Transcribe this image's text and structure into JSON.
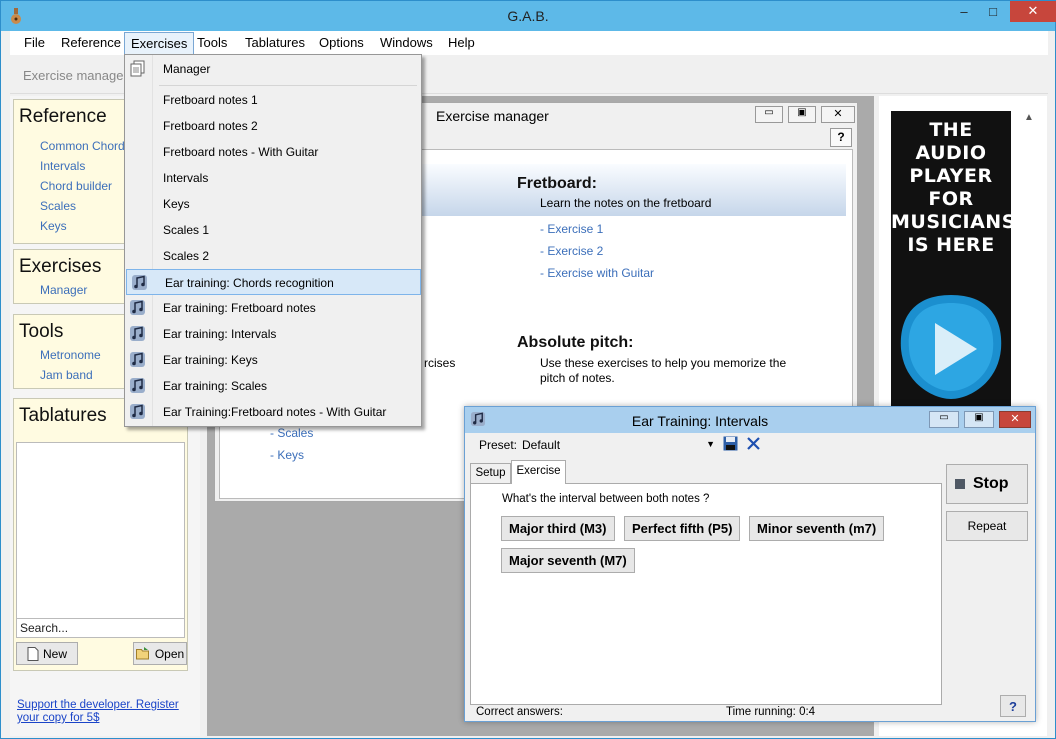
{
  "window": {
    "title": "G.A.B.",
    "minimize": "–",
    "maximize": "□",
    "close": "✕"
  },
  "menubar": [
    "File",
    "Reference",
    "Exercises",
    "Tools",
    "Tablatures",
    "Options",
    "Windows",
    "Help"
  ],
  "toolbar": {
    "exercise_manager": "Exercise manager"
  },
  "sidebar": {
    "reference": {
      "title": "Reference",
      "links": [
        "Common Chords",
        "Intervals",
        "Chord builder",
        "Scales",
        "Keys"
      ]
    },
    "exercises": {
      "title": "Exercises",
      "links": [
        "Manager"
      ]
    },
    "tools": {
      "title": "Tools",
      "links": [
        "Metronome",
        "Jam band"
      ]
    },
    "tablatures": {
      "title": "Tablatures",
      "search_value": "Search...",
      "new_label": "New",
      "open_label": "Open"
    },
    "support_line1": "Support the developer. Register",
    "support_line2": "your copy for 5$"
  },
  "exercises_menu": {
    "manager": "Manager",
    "items": [
      "Fretboard notes 1",
      "Fretboard notes 2",
      "Fretboard notes - With Guitar",
      "Intervals",
      "Keys",
      "Scales 1",
      "Scales 2",
      "Ear training: Chords recognition",
      "Ear training: Fretboard notes",
      "Ear training: Intervals",
      "Ear training: Keys",
      "Ear training: Scales",
      "Ear Training:Fretboard notes - With Guitar"
    ],
    "highlighted_index": 7
  },
  "exercise_manager": {
    "title": "Exercise manager",
    "help": "?",
    "fretboard_title": "Fretboard:",
    "fretboard_desc": "Learn the notes on the fretboard",
    "fretboard_links": [
      "- Exercise 1",
      "- Exercise 2",
      "- Exercise with Guitar"
    ],
    "pitch_title": "Absolute pitch:",
    "pitch_desc_1": "Use these exercises to help you memorize the",
    "pitch_desc_2": "pitch of notes.",
    "left_partial": "rcises",
    "left_links": [
      "- Scales",
      "- Keys"
    ]
  },
  "ear_training": {
    "title": "Ear Training: Intervals",
    "preset_label": "Preset:",
    "preset_value": "Default",
    "tabs": [
      "Setup",
      "Exercise"
    ],
    "active_tab": "Exercise",
    "question": "What's the interval between both notes ?",
    "answers": [
      "Major third (M3)",
      "Perfect fifth (P5)",
      "Minor seventh (m7)",
      "Major seventh (M7)"
    ],
    "stop_label": "Stop",
    "repeat_label": "Repeat",
    "correct_answers": "Correct answers:",
    "time_running": "Time running: 0:4",
    "help": "?"
  },
  "ad": {
    "lines": [
      "THE",
      "AUDIO",
      "PLAYER",
      "FOR",
      "MUSICIANS",
      "IS HERE"
    ]
  },
  "colors": {
    "titlebar": "#5db9e8",
    "link": "#3c6fba",
    "close": "#c7463c",
    "sidebar_bg": "#fffbe1"
  }
}
